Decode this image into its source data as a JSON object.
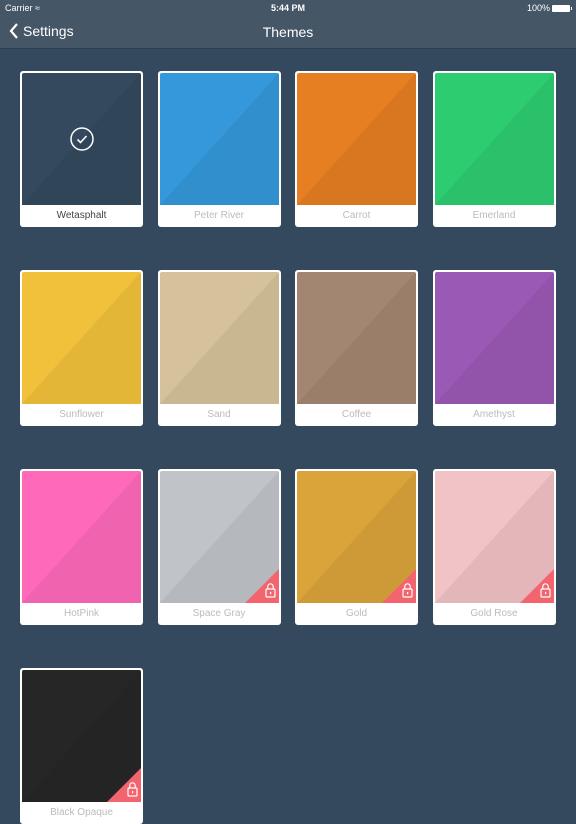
{
  "status_bar": {
    "carrier": "Carrier",
    "time": "5:44 PM",
    "battery": "100%"
  },
  "nav": {
    "back_label": "Settings",
    "title": "Themes"
  },
  "themes": [
    {
      "name": "Wetasphalt",
      "color": "#34495e",
      "selected": true,
      "locked": false
    },
    {
      "name": "Peter River",
      "color": "#3498db",
      "selected": false,
      "locked": false
    },
    {
      "name": "Carrot",
      "color": "#e67e22",
      "selected": false,
      "locked": false
    },
    {
      "name": "Emerland",
      "color": "#2ecc71",
      "selected": false,
      "locked": false
    },
    {
      "name": "Sunflower",
      "color": "#f1c13b",
      "selected": false,
      "locked": false
    },
    {
      "name": "Sand",
      "color": "#d5c29a",
      "selected": false,
      "locked": false
    },
    {
      "name": "Coffee",
      "color": "#a38671",
      "selected": false,
      "locked": false
    },
    {
      "name": "Amethyst",
      "color": "#9b59b6",
      "selected": false,
      "locked": false
    },
    {
      "name": "HotPink",
      "color": "#ff69b9",
      "selected": false,
      "locked": false
    },
    {
      "name": "Space Gray",
      "color": "#c0c4c8",
      "selected": false,
      "locked": true
    },
    {
      "name": "Gold",
      "color": "#dba43b",
      "selected": false,
      "locked": true
    },
    {
      "name": "Gold Rose",
      "color": "#f1c2c6",
      "selected": false,
      "locked": true
    },
    {
      "name": "Black Opaque",
      "color": "#262626",
      "selected": false,
      "locked": true
    }
  ],
  "lock_color": "#f2646e"
}
